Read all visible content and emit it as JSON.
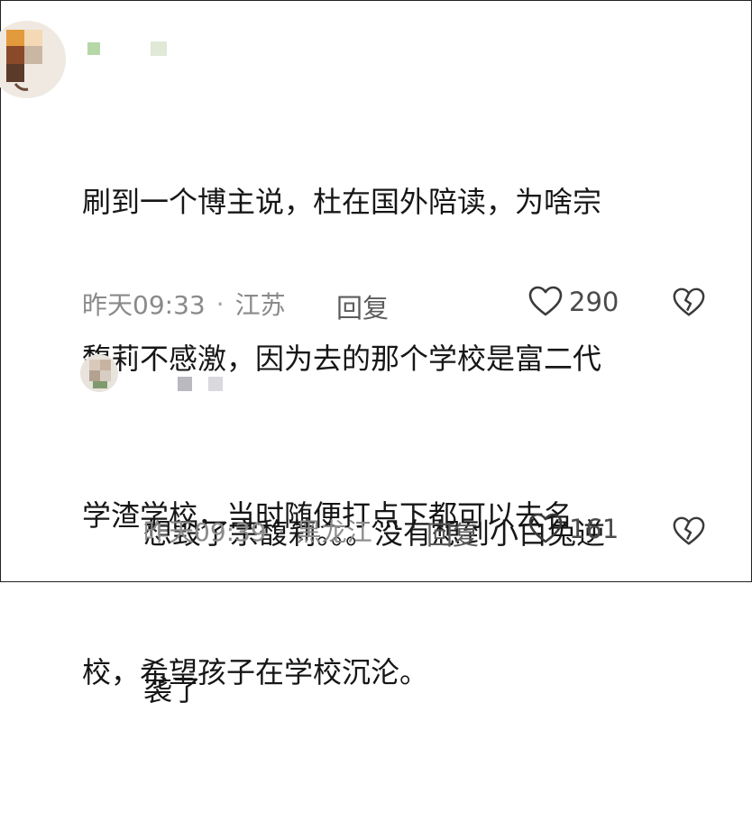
{
  "comments": [
    {
      "username_blurred": true,
      "text_lines": [
        "刷到一个博主说，杜在国外陪读，为啥宗",
        "馥莉不感激，因为去的那个学校是富二代",
        "学渣学校，当时随便打点下都可以去名",
        "校，希望孩子在学校沉沦。"
      ],
      "time": "昨天09:33",
      "location": "江苏",
      "reply_label": "回复",
      "likes": "290",
      "like_icon": "heart-outline-icon",
      "dislike_icon": "broken-heart-icon"
    },
    {
      "username_blurred": true,
      "text_lines": [
        "想毁了宗馥莉。。。没有想到小白兔逆",
        "袭了"
      ],
      "time": "昨天09:39",
      "location": "黑龙江",
      "reply_label": "回复",
      "likes": "161",
      "like_icon": "heart-outline-icon",
      "dislike_icon": "broken-heart-icon"
    }
  ]
}
